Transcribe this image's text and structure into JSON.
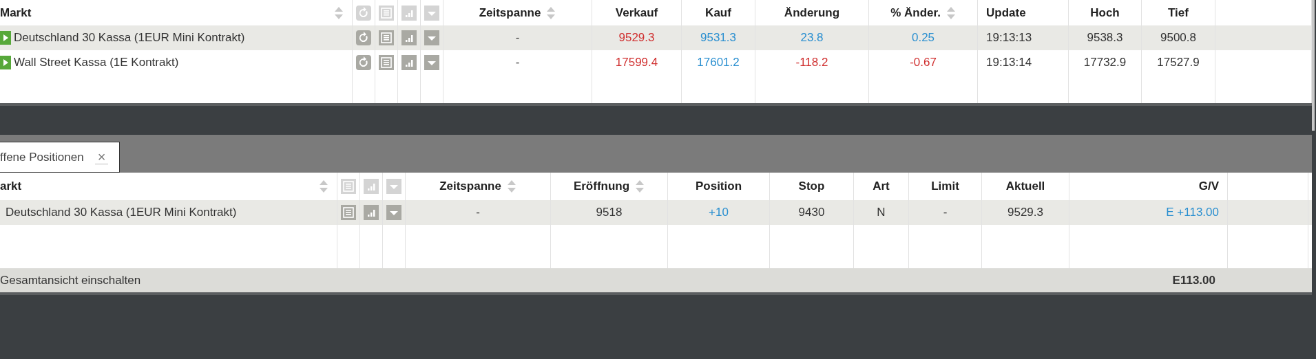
{
  "markets": {
    "columns": [
      {
        "label": "Markt",
        "sortable": true
      },
      {
        "label": "Zeitspanne",
        "sortable": true
      },
      {
        "label": "Verkauf",
        "sortable": false
      },
      {
        "label": "Kauf",
        "sortable": false
      },
      {
        "label": "Änderung",
        "sortable": false
      },
      {
        "label": "% Änder.",
        "sortable": true
      },
      {
        "label": "Update",
        "sortable": false
      },
      {
        "label": "Hoch",
        "sortable": false
      },
      {
        "label": "Tief",
        "sortable": false
      }
    ],
    "rows": [
      {
        "selected": true,
        "cells": [
          {
            "text": "Deutschland 30 Kassa (1EUR Mini Kontrakt)"
          },
          {
            "text": "-"
          },
          {
            "text": "9529.3",
            "color": "#d03030"
          },
          {
            "text": "9531.3",
            "color": "#2a8fd0"
          },
          {
            "text": "23.8",
            "color": "#2a8fd0"
          },
          {
            "text": "0.25",
            "color": "#2a8fd0"
          },
          {
            "text": "19:13:13"
          },
          {
            "text": "9538.3"
          },
          {
            "text": "9500.8"
          }
        ]
      },
      {
        "selected": false,
        "cells": [
          {
            "text": "Wall Street Kassa (1E Kontrakt)"
          },
          {
            "text": "-"
          },
          {
            "text": "17599.4",
            "color": "#d03030"
          },
          {
            "text": "17601.2",
            "color": "#2a8fd0"
          },
          {
            "text": "-118.2",
            "color": "#d03030"
          },
          {
            "text": "-0.67",
            "color": "#d03030"
          },
          {
            "text": "19:13:14"
          },
          {
            "text": "17732.9"
          },
          {
            "text": "17527.9"
          }
        ]
      }
    ]
  },
  "tab": {
    "label": "ffene Positionen",
    "close": "×"
  },
  "positions": {
    "columns": [
      {
        "label": "arkt",
        "sortable": true
      },
      {
        "label": "Zeitspanne",
        "sortable": true
      },
      {
        "label": "Eröffnung",
        "sortable": true
      },
      {
        "label": "Position",
        "sortable": false
      },
      {
        "label": "Stop",
        "sortable": false
      },
      {
        "label": "Art",
        "sortable": false
      },
      {
        "label": "Limit",
        "sortable": false
      },
      {
        "label": "Aktuell",
        "sortable": false
      },
      {
        "label": "G/V",
        "sortable": false
      }
    ],
    "rows": [
      {
        "selected": true,
        "cells": [
          {
            "text": "Deutschland 30 Kassa (1EUR Mini Kontrakt)"
          },
          {
            "text": "-"
          },
          {
            "text": "9518"
          },
          {
            "text": "+10",
            "color": "#2a8fd0"
          },
          {
            "text": "9430"
          },
          {
            "text": "N"
          },
          {
            "text": "-"
          },
          {
            "text": "9529.3"
          },
          {
            "text": "E +113.00",
            "color": "#2a8fd0"
          }
        ]
      }
    ],
    "footer": {
      "label": "Gesamtansicht einschalten",
      "total": "E113.00"
    }
  }
}
